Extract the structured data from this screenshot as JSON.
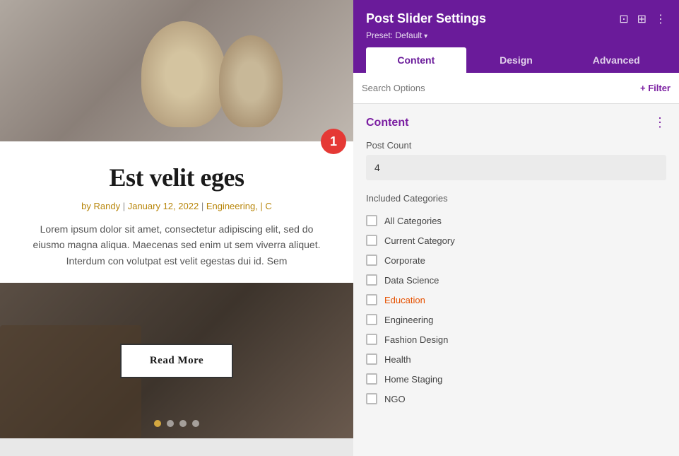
{
  "panel": {
    "title": "Post Slider Settings",
    "preset_label": "Preset: Default",
    "tabs": [
      {
        "id": "content",
        "label": "Content",
        "active": true
      },
      {
        "id": "design",
        "label": "Design",
        "active": false
      },
      {
        "id": "advanced",
        "label": "Advanced",
        "active": false
      }
    ],
    "search_placeholder": "Search Options",
    "filter_label": "+ Filter",
    "section_title": "Content",
    "post_count_label": "Post Count",
    "post_count_value": "4",
    "categories_label": "Included Categories",
    "categories": [
      {
        "id": "all",
        "name": "All Categories",
        "checked": false
      },
      {
        "id": "current",
        "name": "Current Category",
        "checked": false
      },
      {
        "id": "corporate",
        "name": "Corporate",
        "checked": false
      },
      {
        "id": "data-science",
        "name": "Data Science",
        "checked": false
      },
      {
        "id": "education",
        "name": "Education",
        "checked": false,
        "highlight": true
      },
      {
        "id": "engineering",
        "name": "Engineering",
        "checked": false
      },
      {
        "id": "fashion",
        "name": "Fashion Design",
        "checked": false
      },
      {
        "id": "health",
        "name": "Health",
        "checked": false
      },
      {
        "id": "home",
        "name": "Home Staging",
        "checked": false
      },
      {
        "id": "ngo",
        "name": "NGO",
        "checked": false
      }
    ]
  },
  "preview": {
    "title": "Est velit eges",
    "meta": "by Randy | January 12, 2022 | Engineering, | C",
    "body": "Lorem ipsum dolor sit amet, consectetur adipiscing elit, sed do eiusmo magna aliqua. Maecenas sed enim ut sem viverra aliquet. Interdum con volutpat est velit egestas dui id. Sem",
    "read_more": "Read More",
    "dots": [
      {
        "active": true
      },
      {
        "active": false
      },
      {
        "active": false
      },
      {
        "active": false
      }
    ]
  },
  "badge": {
    "value": "1"
  }
}
